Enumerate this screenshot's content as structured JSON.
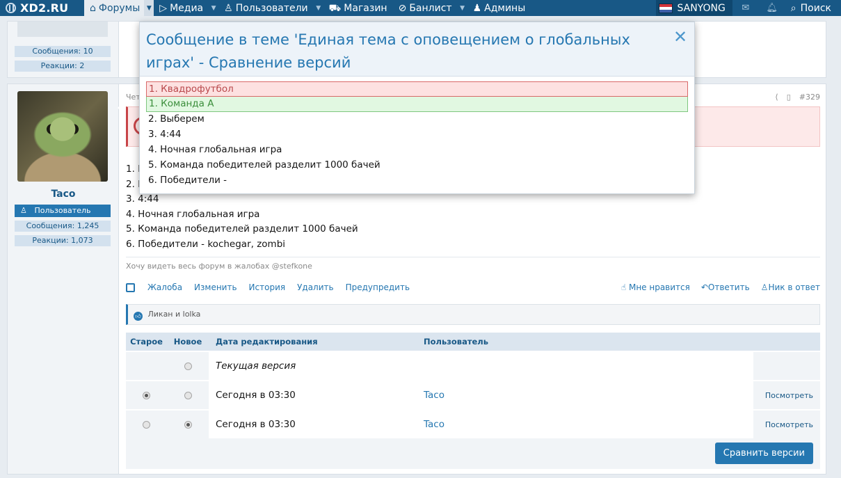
{
  "nav": {
    "logo": "XD2.RU",
    "items": [
      {
        "label": "Форумы",
        "icon": "home-icon"
      },
      {
        "label": "Медиа",
        "icon": "play-icon"
      },
      {
        "label": "Пользователи",
        "icon": "user-icon"
      },
      {
        "label": "Магазин",
        "icon": "cart-icon"
      },
      {
        "label": "Банлист",
        "icon": "user-slash-icon"
      },
      {
        "label": "Админы",
        "icon": "users-icon"
      }
    ],
    "username": "SANYONG",
    "search": "Поиск"
  },
  "prev_post": {
    "messages": "Сообщения: 10",
    "reactions": "Реакции: 2"
  },
  "post": {
    "username": "Taco",
    "role": "Пользователь",
    "messages": "Сообщения: 1,245",
    "reactions": "Реакции: 1,073",
    "head_left": "Чет",
    "number": "#329",
    "body_visible": [
      "1. К",
      "2. В",
      "3. 4:44",
      "4. Ночная глобальная игра",
      "5. Команда победителей разделит 1000 бачей",
      "6. Победители - kochegar, zombi"
    ],
    "signature": "Хочу видеть весь форум в жалобах @stefkone",
    "actions_left": [
      "Жалоба",
      "Изменить",
      "История",
      "Удалить",
      "Предупредить"
    ],
    "actions_right": [
      "Мне нравится",
      "Ответить",
      "Ник в ответ"
    ],
    "likes": "Ликан и lolka"
  },
  "history": {
    "headers": {
      "old": "Старое",
      "new": "Новое",
      "date": "Дата редактирования",
      "user": "Пользователь"
    },
    "rows": [
      {
        "date": "Текущая версия",
        "user": "",
        "view": "",
        "old": false,
        "new": false,
        "has_old": false,
        "italic": true
      },
      {
        "date": "Сегодня в 03:30",
        "user": "Taco",
        "view": "Посмотреть",
        "old": true,
        "new": false,
        "has_old": true
      },
      {
        "date": "Сегодня в 03:30",
        "user": "Taco",
        "view": "Посмотреть",
        "old": false,
        "new": true,
        "has_old": true
      }
    ],
    "compare_button": "Сравнить версии"
  },
  "modal": {
    "title": "Сообщение в теме 'Единая тема с оповещением о глобальных играх' - Сравнение версий",
    "diff": [
      {
        "type": "del",
        "text": "1. Квадрофутбол"
      },
      {
        "type": "ins",
        "text": "1. Команда A"
      },
      {
        "type": "same",
        "text": "2. Выберем"
      },
      {
        "type": "same",
        "text": "3. 4:44"
      },
      {
        "type": "same",
        "text": "4. Ночная глобальная игра"
      },
      {
        "type": "same",
        "text": "5. Команда победителей разделит 1000 бачей"
      },
      {
        "type": "same",
        "text": "6. Победители -"
      }
    ]
  }
}
